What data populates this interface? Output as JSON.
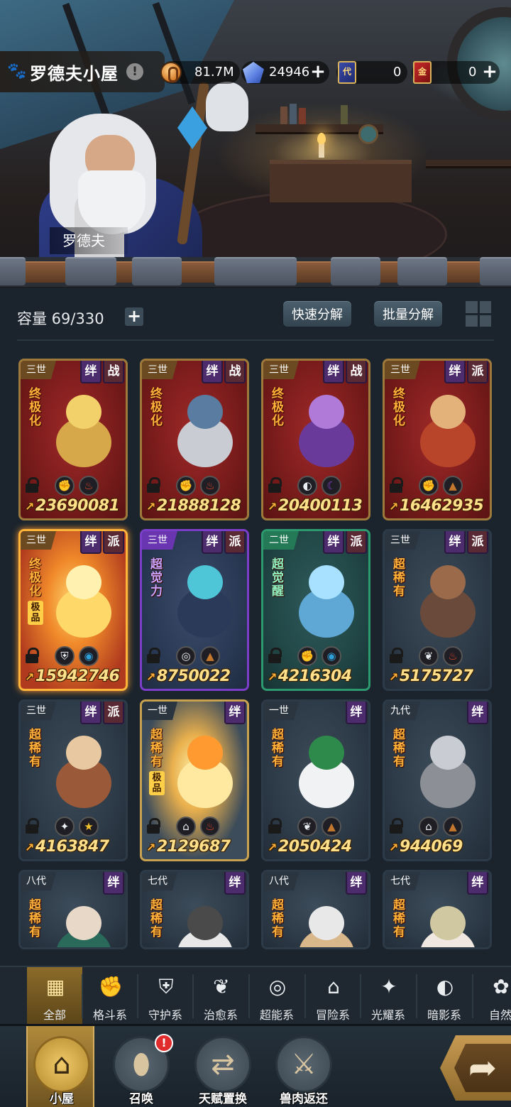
{
  "header": {
    "title": "罗德夫小屋",
    "info_glyph": "!",
    "paw_icon": "paw-icon",
    "resources": [
      {
        "name": "gold-coin",
        "value": "81.7M"
      },
      {
        "name": "diamond",
        "value": "24946"
      },
      {
        "name": "generation-card",
        "label": "代",
        "value": "0"
      },
      {
        "name": "gold-card",
        "label": "金",
        "value": "0"
      }
    ],
    "plus": "+"
  },
  "scene": {
    "npc_name": "罗德夫"
  },
  "storage": {
    "capacity_label": "容量 69/330",
    "plus": "+",
    "quick_decompose": "快速分解",
    "batch_decompose": "批量分解"
  },
  "cards": [
    {
      "gen": "三世",
      "tags": [
        "绊",
        "战"
      ],
      "rank": "终极化",
      "extra": "",
      "elements": [
        "fist-icon",
        "fire-icon"
      ],
      "power": "23690081",
      "style": "red"
    },
    {
      "gen": "三世",
      "tags": [
        "绊",
        "战"
      ],
      "rank": "终极化",
      "extra": "",
      "elements": [
        "fist-icon",
        "fire-icon"
      ],
      "power": "21888128",
      "style": "red"
    },
    {
      "gen": "三世",
      "tags": [
        "绊",
        "战"
      ],
      "rank": "终极化",
      "extra": "",
      "elements": [
        "shadow-icon",
        "moon-icon"
      ],
      "power": "20400113",
      "style": "red"
    },
    {
      "gen": "三世",
      "tags": [
        "绊",
        "派"
      ],
      "rank": "终极化",
      "extra": "",
      "elements": [
        "fist-icon",
        "earth-icon"
      ],
      "power": "16462935",
      "style": "red"
    },
    {
      "gen": "三世",
      "tags": [
        "绊",
        "派"
      ],
      "rank": "终极化",
      "extra": "极品",
      "elements": [
        "shield-icon",
        "water-icon"
      ],
      "power": "15942746",
      "style": "glow"
    },
    {
      "gen": "三世",
      "tags": [
        "绊",
        "派"
      ],
      "rank": "超觉力",
      "extra": "",
      "elements": [
        "psychic-icon",
        "earth-icon"
      ],
      "power": "8750022",
      "style": "purple"
    },
    {
      "gen": "二世",
      "tags": [
        "绊",
        "派"
      ],
      "rank": "超觉醒",
      "extra": "",
      "elements": [
        "fist-icon",
        "water-icon"
      ],
      "power": "4216304",
      "style": "green"
    },
    {
      "gen": "三世",
      "tags": [
        "绊",
        "派"
      ],
      "rank": "超稀有",
      "extra": "",
      "elements": [
        "leaf-icon",
        "fire-icon"
      ],
      "power": "5175727",
      "style": "slate"
    },
    {
      "gen": "三世",
      "tags": [
        "绊",
        "派"
      ],
      "rank": "超稀有",
      "extra": "",
      "elements": [
        "light-icon",
        "star-icon"
      ],
      "power": "4163847",
      "style": "slate"
    },
    {
      "gen": "一世",
      "tags": [
        "绊"
      ],
      "rank": "超稀有",
      "extra": "极品",
      "elements": [
        "adventure-icon",
        "fire-icon"
      ],
      "power": "2129687",
      "style": "gold"
    },
    {
      "gen": "一世",
      "tags": [
        "绊"
      ],
      "rank": "超稀有",
      "extra": "",
      "elements": [
        "leaf-icon",
        "earth-icon"
      ],
      "power": "2050424",
      "style": "slate"
    },
    {
      "gen": "九代",
      "tags": [
        "绊"
      ],
      "rank": "超稀有",
      "extra": "",
      "elements": [
        "adventure-icon",
        "earth-icon"
      ],
      "power": "944069",
      "style": "slate"
    },
    {
      "gen": "八代",
      "tags": [
        "绊"
      ],
      "rank": "超稀有",
      "extra": "",
      "elements": [],
      "power": "",
      "style": "slate"
    },
    {
      "gen": "七代",
      "tags": [
        "绊"
      ],
      "rank": "超稀有",
      "extra": "",
      "elements": [],
      "power": "",
      "style": "slate"
    },
    {
      "gen": "八代",
      "tags": [
        "绊"
      ],
      "rank": "超稀有",
      "extra": "",
      "elements": [],
      "power": "",
      "style": "slate"
    },
    {
      "gen": "七代",
      "tags": [
        "绊"
      ],
      "rank": "超稀有",
      "extra": "",
      "elements": [],
      "power": "",
      "style": "slate"
    }
  ],
  "categories": [
    {
      "label": "全部",
      "icon": "all-icon",
      "active": true
    },
    {
      "label": "格斗系",
      "icon": "fist-icon"
    },
    {
      "label": "守护系",
      "icon": "shield-icon"
    },
    {
      "label": "治愈系",
      "icon": "leaf-icon"
    },
    {
      "label": "超能系",
      "icon": "psychic-icon"
    },
    {
      "label": "冒险系",
      "icon": "adventure-icon"
    },
    {
      "label": "光耀系",
      "icon": "light-icon"
    },
    {
      "label": "暗影系",
      "icon": "shadow-icon"
    },
    {
      "label": "自然",
      "icon": "nature-icon"
    }
  ],
  "nav": [
    {
      "label": "小屋",
      "icon": "house-icon",
      "active": true
    },
    {
      "label": "召唤",
      "icon": "egg-icon",
      "badge": "!"
    },
    {
      "label": "天赋置换",
      "icon": "swap-icon"
    },
    {
      "label": "兽肉返还",
      "icon": "meat-icon"
    }
  ],
  "go_button": {
    "icon": "go-arrow-icon"
  }
}
